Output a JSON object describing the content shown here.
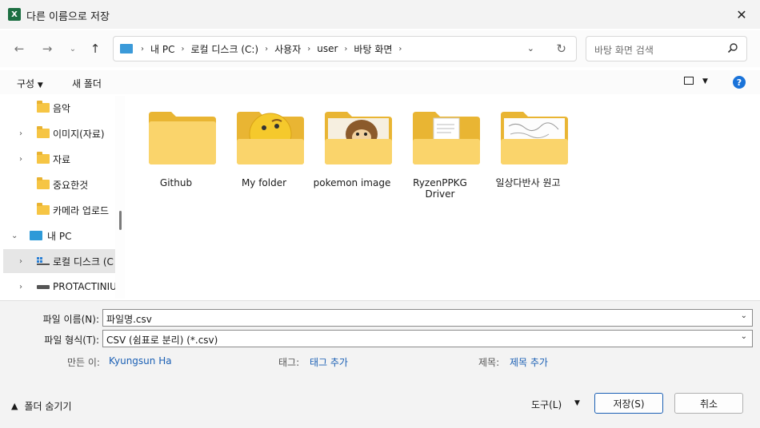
{
  "window": {
    "title": "다른 이름으로 저장",
    "app_icon": "X"
  },
  "nav": {
    "breadcrumb": [
      "내 PC",
      "로컬 디스크 (C:)",
      "사용자",
      "user",
      "바탕 화면"
    ],
    "search_placeholder": "바탕 화면 검색"
  },
  "toolbar": {
    "organize": "구성",
    "new_folder": "새 폴더",
    "help": "?"
  },
  "sidebar": {
    "items": [
      {
        "label": "음악"
      },
      {
        "label": "이미지(자료)"
      },
      {
        "label": "자료"
      },
      {
        "label": "중요한것"
      },
      {
        "label": "카메라 업로드"
      },
      {
        "label": "내 PC"
      },
      {
        "label": "로컬 디스크 (C"
      },
      {
        "label": "PROTACTINIUI"
      }
    ]
  },
  "files": [
    {
      "name": "Github"
    },
    {
      "name": "My folder"
    },
    {
      "name": "pokemon image"
    },
    {
      "name": "RyzenPPKG Driver"
    },
    {
      "name": "일상다반사 원고"
    }
  ],
  "form": {
    "filename_label": "파일 이름(N):",
    "filename_value": "파일명.csv",
    "filetype_label": "파일 형식(T):",
    "filetype_value": "CSV (쉼표로 분리) (*.csv)",
    "author_label": "만든 이:",
    "author_value": "Kyungsun Ha",
    "tags_label": "태그:",
    "tags_value": "태그 추가",
    "title_label": "제목:",
    "title_value": "제목 추가"
  },
  "buttons": {
    "hide_folders": "폴더 숨기기",
    "tools": "도구(L)",
    "save": "저장(S)",
    "cancel": "취소"
  }
}
